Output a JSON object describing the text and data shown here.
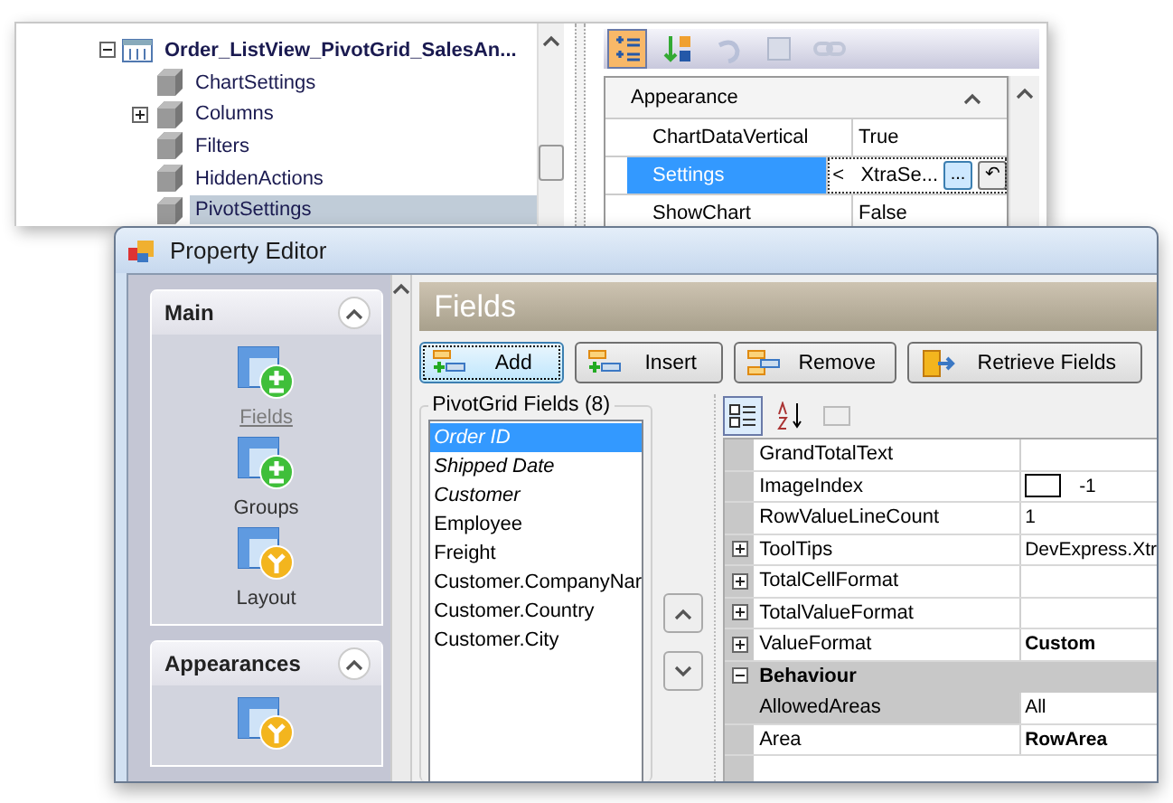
{
  "model_tree": {
    "root": {
      "label": "Order_ListView_PivotGrid_SalesAn...",
      "expanded": true,
      "children": [
        {
          "label": "ChartSettings",
          "expandable": false,
          "selected": false
        },
        {
          "label": "Columns",
          "expandable": true,
          "selected": false
        },
        {
          "label": "Filters",
          "expandable": false,
          "selected": false
        },
        {
          "label": "HiddenActions",
          "expandable": false,
          "selected": false
        },
        {
          "label": "PivotSettings",
          "expandable": false,
          "selected": true
        }
      ]
    }
  },
  "model_properties": {
    "category": "Appearance",
    "rows": [
      {
        "name": "ChartDataVertical",
        "value": "True",
        "selected": false
      },
      {
        "name": "Settings",
        "value": "<   XtraSe...",
        "selected": true,
        "ellipsis_button": "...",
        "reset_button": "↶"
      },
      {
        "name": "ShowChart",
        "value": "False",
        "selected": false
      }
    ]
  },
  "window": {
    "title": "Property Editor"
  },
  "nav_groups": [
    {
      "title": "Main",
      "expanded": true,
      "items": [
        {
          "kind": "labeled",
          "label": "Fields",
          "selected": true
        },
        {
          "kind": "labeled",
          "label": "Groups",
          "selected": false
        },
        {
          "kind": "labeled",
          "label": "Layout",
          "selected": false
        }
      ]
    },
    {
      "title": "Appearances",
      "expanded": true,
      "items": [
        {
          "kind": "icon_only"
        }
      ]
    }
  ],
  "page_title": "Fields",
  "buttons": [
    {
      "label": "Add",
      "focused": true
    },
    {
      "label": "Insert",
      "focused": false
    },
    {
      "label": "Remove",
      "focused": false
    },
    {
      "label": "Retrieve Fields",
      "focused": false
    }
  ],
  "fields_list": {
    "title": "PivotGrid Fields (8)",
    "items": [
      {
        "label": "Order ID",
        "in_layout": true,
        "selected": true
      },
      {
        "label": "Shipped Date",
        "in_layout": true,
        "selected": false
      },
      {
        "label": "Customer",
        "in_layout": true,
        "selected": false
      },
      {
        "label": "Employee",
        "in_layout": false,
        "selected": false
      },
      {
        "label": "Freight",
        "in_layout": false,
        "selected": false
      },
      {
        "label": "Customer.CompanyNar",
        "in_layout": false,
        "selected": false
      },
      {
        "label": "Customer.Country",
        "in_layout": false,
        "selected": false
      },
      {
        "label": "Customer.City",
        "in_layout": false,
        "selected": false
      }
    ]
  },
  "field_properties": [
    {
      "kind": "row",
      "name": "GrandTotalText",
      "selected": false
    },
    {
      "kind": "row",
      "name": "ImageIndex",
      "value": "-1",
      "swatch": true,
      "selected": false
    },
    {
      "kind": "row",
      "name": "RowValueLineCount",
      "value": "1",
      "selected": false
    },
    {
      "kind": "row",
      "name": "ToolTips",
      "value": "DevExpress.Xtr",
      "expanded": false,
      "selected": false
    },
    {
      "kind": "row",
      "name": "TotalCellFormat",
      "expanded": false,
      "selected": false
    },
    {
      "kind": "row",
      "name": "TotalValueFormat",
      "expanded": false,
      "selected": false
    },
    {
      "kind": "row",
      "name": "ValueFormat",
      "value": "Custom",
      "expanded": false,
      "modified": true,
      "selected": false
    },
    {
      "kind": "category",
      "name": "Behaviour",
      "expanded": true
    },
    {
      "kind": "row",
      "name": "AllowedAreas",
      "value": "All",
      "selected": true
    },
    {
      "kind": "row",
      "name": "Area",
      "value": "RowArea",
      "modified": true,
      "selected": false
    }
  ]
}
